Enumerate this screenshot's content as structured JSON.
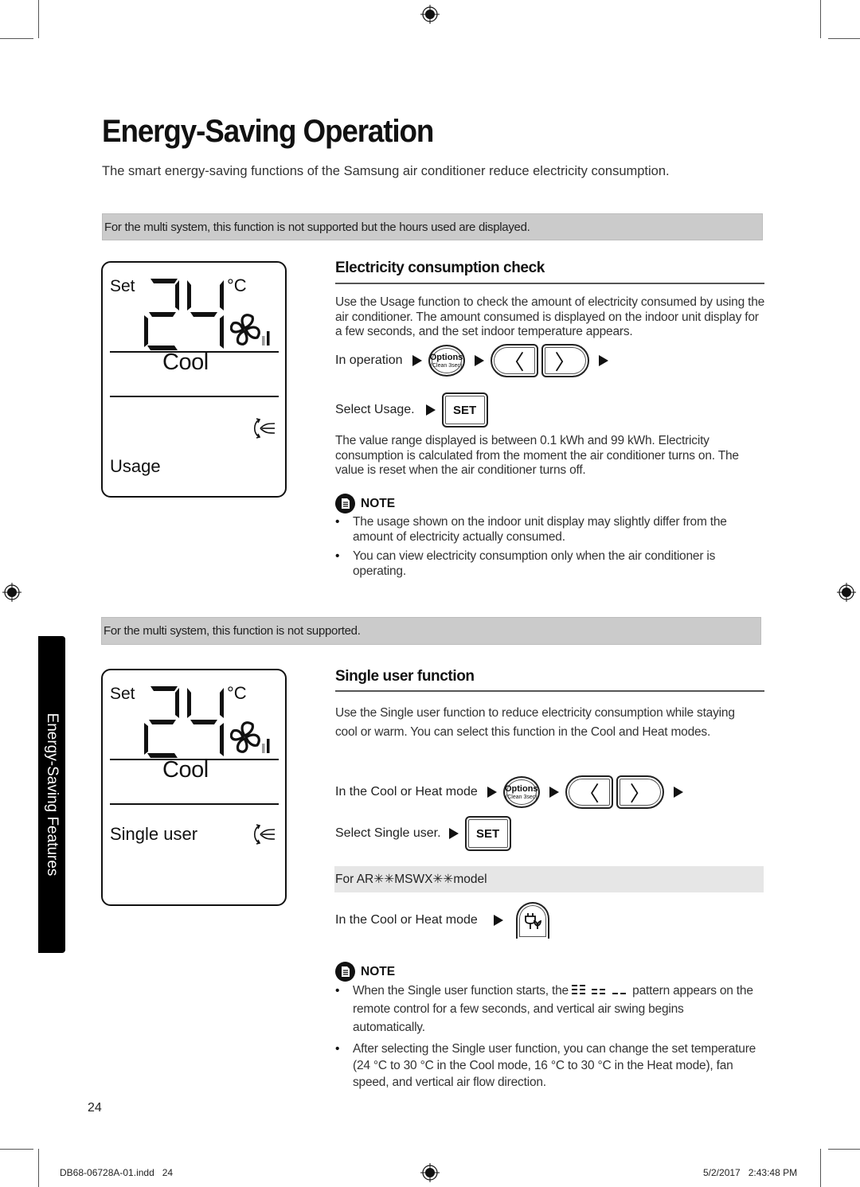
{
  "page": {
    "title": "Energy-Saving Operation",
    "intro": "The smart energy-saving functions of the Samsung air conditioner reduce electricity consumption.",
    "side_tab": "Energy-Saving Features",
    "page_number": "24",
    "footer_file": "DB68-06728A-01.indd   24",
    "footer_timestamp": "5/2/2017   2:43:48 PM"
  },
  "usage_section": {
    "notice": "For the multi system, this function is not supported but the hours used are displayed.",
    "display": {
      "set_label": "Set",
      "temperature": "24",
      "unit": "°C",
      "mode": "Cool",
      "function": "Usage",
      "fan_level": 2,
      "fan_level_max": 3
    },
    "heading": "Electricity consumption check",
    "description": "Use the Usage function to check the amount of electricity consumed by using the air conditioner. The amount consumed is displayed on the indoor unit display for a few seconds, and the set indoor temperature appears.",
    "step1_label": "In operation",
    "step2_label": "Select Usage.",
    "range_text": "The value range displayed is between 0.1 kWh and 99 kWh. Electricity consumption is calculated from the moment the air conditioner turns on. The value is reset when the air conditioner turns off.",
    "note_label": "NOTE",
    "notes": [
      "The usage shown on the indoor unit display may slightly differ from the amount of electricity actually consumed.",
      "You can view electricity consumption only when the air conditioner is operating."
    ]
  },
  "single_user_section": {
    "notice": "For the multi system, this function is not supported.",
    "display": {
      "set_label": "Set",
      "temperature": "24",
      "unit": "°C",
      "mode": "Cool",
      "function": "Single user",
      "fan_level": 2,
      "fan_level_max": 3
    },
    "heading": "Single user function",
    "description": "Use the Single user function to reduce electricity consumption while staying cool or warm. You can select this function in the Cool and Heat modes.",
    "step1_label": "In the Cool or Heat mode",
    "step2_label": "Select Single user.",
    "model_note": "For AR✳✳MSWX✳✳model",
    "step3_label": "In the Cool or Heat mode",
    "note_label": "NOTE",
    "note1_before": "When the Single user function starts, the",
    "note1_after": "pattern appears on the remote control for a few seconds, and vertical air swing begins automatically.",
    "note2": "After selecting the Single user function, you can change the set temperature (24 °C to 30 °C in the Cool mode, 16 °C to 30 °C in the Heat mode), fan speed, and vertical air flow direction."
  },
  "buttons": {
    "options_label": "Options",
    "options_sub": "(Clean 3sec)",
    "left_glyph": "〈",
    "right_glyph": "〉",
    "set_label": "SET"
  },
  "icons": {
    "note": "note-document-icon",
    "fan": "fan-icon",
    "swing": "air-swing-icon",
    "plug": "plug-leaf-icon",
    "registration": "registration-mark-icon"
  }
}
